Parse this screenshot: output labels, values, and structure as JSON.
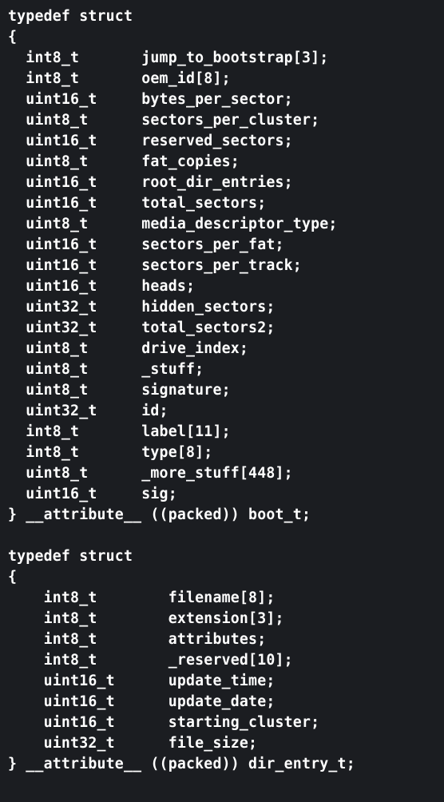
{
  "code": {
    "struct1": {
      "open": "typedef struct\n{",
      "fields": [
        {
          "type": "int8_t",
          "name": "jump_to_bootstrap[3];"
        },
        {
          "type": "int8_t",
          "name": "oem_id[8];"
        },
        {
          "type": "uint16_t",
          "name": "bytes_per_sector;"
        },
        {
          "type": "uint8_t",
          "name": "sectors_per_cluster;"
        },
        {
          "type": "uint16_t",
          "name": "reserved_sectors;"
        },
        {
          "type": "uint8_t",
          "name": "fat_copies;"
        },
        {
          "type": "uint16_t",
          "name": "root_dir_entries;"
        },
        {
          "type": "uint16_t",
          "name": "total_sectors;"
        },
        {
          "type": "uint8_t",
          "name": "media_descriptor_type;"
        },
        {
          "type": "uint16_t",
          "name": "sectors_per_fat;"
        },
        {
          "type": "uint16_t",
          "name": "sectors_per_track;"
        },
        {
          "type": "uint16_t",
          "name": "heads;"
        },
        {
          "type": "uint32_t",
          "name": "hidden_sectors;"
        },
        {
          "type": "uint32_t",
          "name": "total_sectors2;"
        },
        {
          "type": "uint8_t",
          "name": "drive_index;"
        },
        {
          "type": "uint8_t",
          "name": "_stuff;"
        },
        {
          "type": "uint8_t",
          "name": "signature;"
        },
        {
          "type": "uint32_t",
          "name": "id;"
        },
        {
          "type": "int8_t",
          "name": "label[11];"
        },
        {
          "type": "int8_t",
          "name": "type[8];"
        },
        {
          "type": "uint8_t",
          "name": "_more_stuff[448];"
        },
        {
          "type": "uint16_t",
          "name": "sig;"
        }
      ],
      "close": "} __attribute__ ((packed)) boot_t;",
      "field_indent": 2,
      "type_col": 2,
      "name_col": 15
    },
    "blank": "",
    "struct2": {
      "open": "typedef struct\n{",
      "fields": [
        {
          "type": "int8_t",
          "name": "filename[8];"
        },
        {
          "type": "int8_t",
          "name": "extension[3];"
        },
        {
          "type": "int8_t",
          "name": "attributes;"
        },
        {
          "type": "int8_t",
          "name": "_reserved[10];"
        },
        {
          "type": "uint16_t",
          "name": "update_time;"
        },
        {
          "type": "uint16_t",
          "name": "update_date;"
        },
        {
          "type": "uint16_t",
          "name": "starting_cluster;"
        },
        {
          "type": "uint32_t",
          "name": "file_size;"
        }
      ],
      "close": "} __attribute__ ((packed)) dir_entry_t;",
      "field_indent": 4,
      "type_col": 4,
      "name_col": 18
    }
  }
}
